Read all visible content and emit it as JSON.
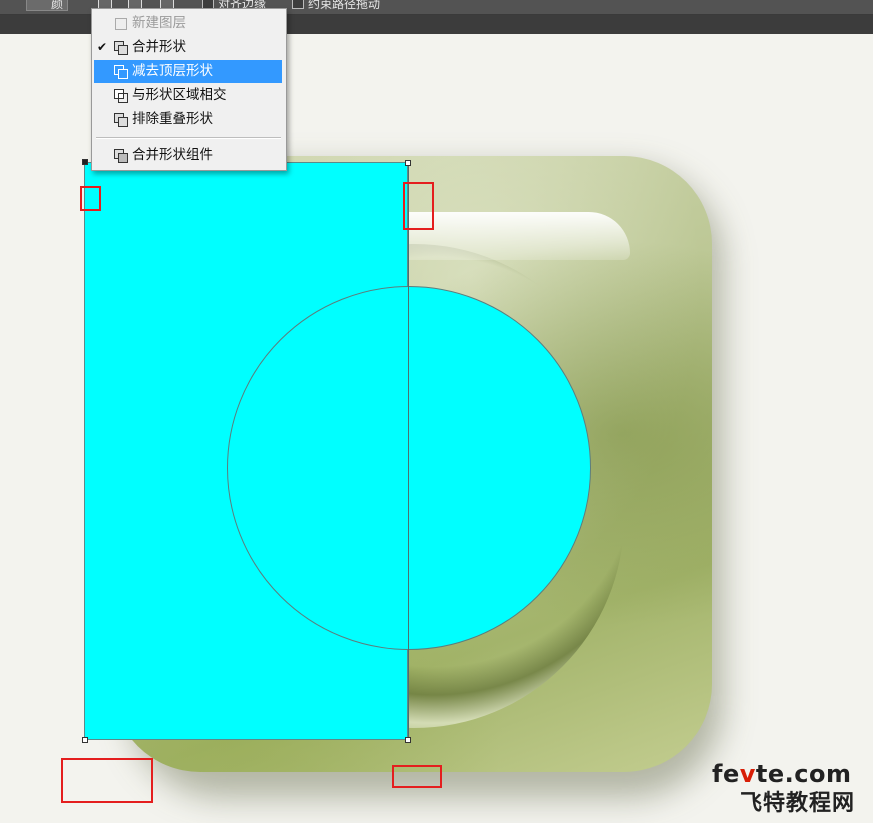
{
  "toolbar": {
    "text_1": "颜",
    "text_2": "对齐边缘",
    "text_3": "约束路径拖动"
  },
  "path_ops_menu": {
    "items": [
      {
        "label": "新建图层",
        "checked": false,
        "disabled": true,
        "highlighted": false
      },
      {
        "label": "合并形状",
        "checked": true,
        "disabled": false,
        "highlighted": false
      },
      {
        "label": "减去顶层形状",
        "checked": false,
        "disabled": false,
        "highlighted": true
      },
      {
        "label": "与形状区域相交",
        "checked": false,
        "disabled": false,
        "highlighted": false
      },
      {
        "label": "排除重叠形状",
        "checked": false,
        "disabled": false,
        "highlighted": false
      },
      {
        "label": "合并形状组件",
        "checked": false,
        "disabled": false,
        "highlighted": false
      }
    ],
    "check_mark": "✔"
  },
  "canvas": {
    "shape_color": "#00ffff",
    "highlight_box_color": "#e41e1e"
  },
  "watermark": {
    "line1_a": "fe",
    "line1_b": "v",
    "line1_c": "te.com",
    "line2": "飞特教程网"
  },
  "colors": {
    "menu_highlight": "#3399ff",
    "toolbar_bg": "#535353"
  }
}
